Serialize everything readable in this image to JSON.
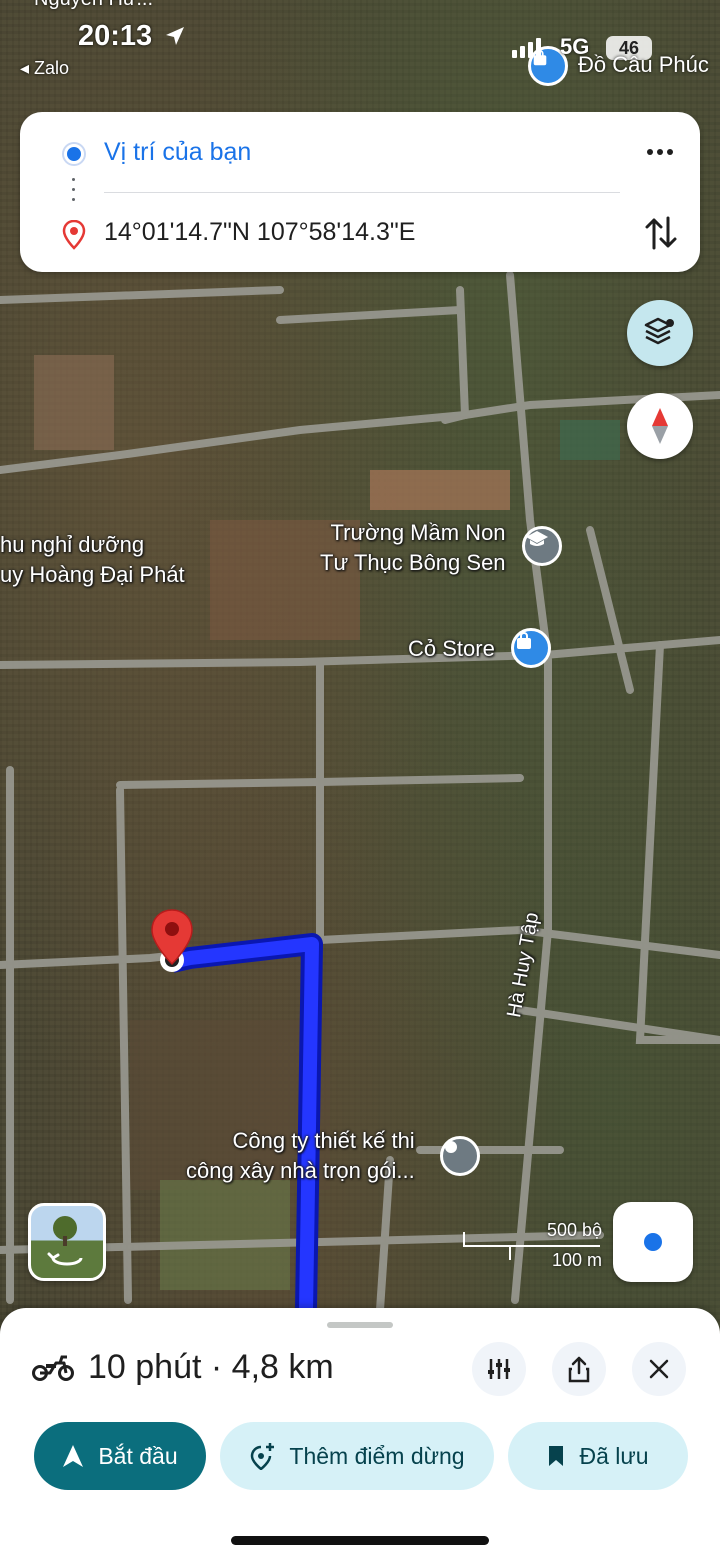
{
  "status_bar": {
    "time": "20:13",
    "back_app": "◂ Zalo",
    "network": "5G",
    "battery": "46",
    "top_left_label": "Nguyễn Hữ..."
  },
  "map": {
    "top_poi": "Đồ Câu Phúc",
    "pois": [
      {
        "line1": "hu nghỉ dưỡng",
        "line2": "uy Hoàng Đại Phát"
      },
      {
        "line1": "Trường Mầm Non",
        "line2": "Tư Thục Bông Sen"
      },
      {
        "line1": "Cỏ Store",
        "line2": ""
      },
      {
        "line1": "Công ty thiết kế thi",
        "line2": "công xây nhà trọn gói..."
      }
    ],
    "road_label": "Hà Huy Tập",
    "scale": {
      "top": "500 bộ",
      "bottom": "100 m"
    }
  },
  "route_card": {
    "origin": "Vị trí của bạn",
    "destination": "14°01'14.7\"N 107°58'14.3\"E"
  },
  "sheet": {
    "summary": "10 phút · 4,8 km",
    "start_label": "Bắt đầu",
    "add_stop_label": "Thêm điểm dừng",
    "saved_label": "Đã lưu"
  },
  "colors": {
    "route": "#1a2cff",
    "primary": "#0b6e7d",
    "tonal": "#d6f1f7",
    "origin_dot": "#1a73e8",
    "destination_pin": "#e53935"
  }
}
